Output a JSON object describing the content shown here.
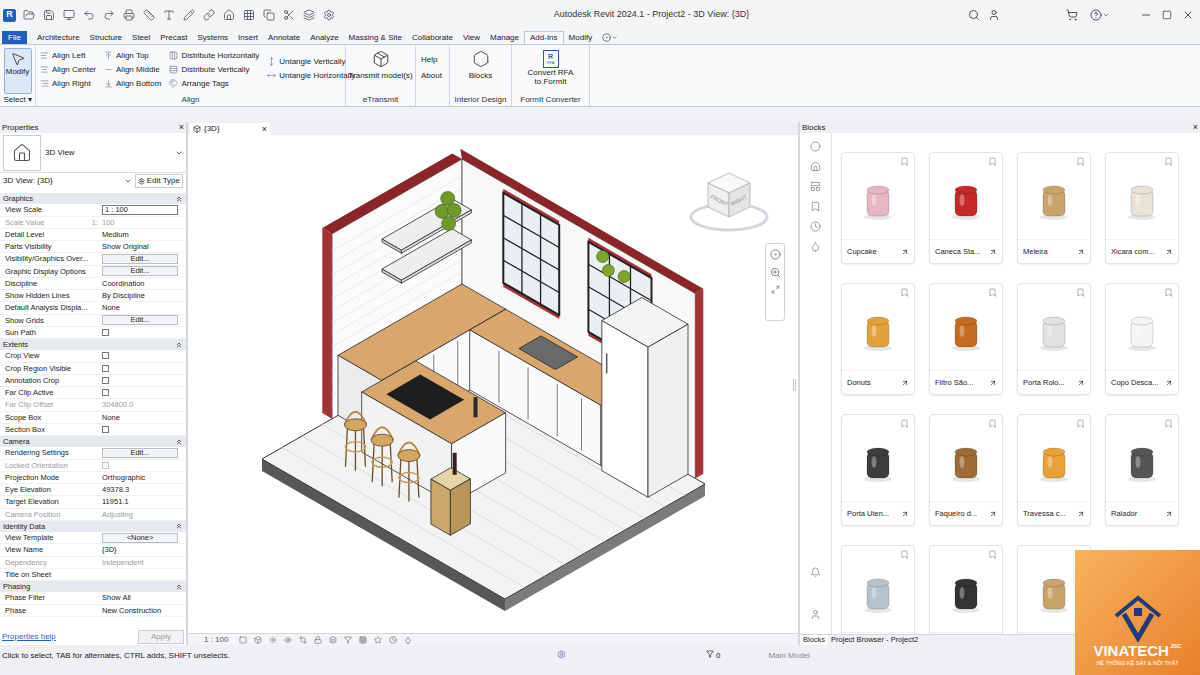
{
  "window": {
    "title": "Autodesk Revit 2024.1 - Project2 - 3D View: {3D}",
    "app_badge": "R"
  },
  "menu_tabs": [
    {
      "label": "File",
      "selected": false,
      "kind": "file"
    },
    {
      "label": "Architecture",
      "selected": false,
      "kind": "tab"
    },
    {
      "label": "Structure",
      "selected": false,
      "kind": "tab"
    },
    {
      "label": "Steel",
      "selected": false,
      "kind": "tab"
    },
    {
      "label": "Precast",
      "selected": false,
      "kind": "tab"
    },
    {
      "label": "Systems",
      "selected": false,
      "kind": "tab"
    },
    {
      "label": "Insert",
      "selected": false,
      "kind": "tab"
    },
    {
      "label": "Annotate",
      "selected": false,
      "kind": "tab"
    },
    {
      "label": "Analyze",
      "selected": false,
      "kind": "tab"
    },
    {
      "label": "Massing & Site",
      "selected": false,
      "kind": "tab"
    },
    {
      "label": "Collaborate",
      "selected": false,
      "kind": "tab"
    },
    {
      "label": "View",
      "selected": false,
      "kind": "tab"
    },
    {
      "label": "Manage",
      "selected": false,
      "kind": "tab"
    },
    {
      "label": "Add-Ins",
      "selected": true,
      "kind": "tab"
    },
    {
      "label": "Modify",
      "selected": false,
      "kind": "tab"
    }
  ],
  "ribbon": {
    "modify": {
      "label": "Modify",
      "selected": true
    },
    "select": {
      "label": "Select",
      "caret": "▾"
    },
    "align_panel": {
      "title": "Align",
      "columns": [
        [
          "Align Left",
          "Align Center",
          "Align Right"
        ],
        [
          "Align Top",
          "Align Middle",
          "Align Bottom"
        ],
        [
          "Distribute Horizontally",
          "Distribute Vertically",
          "Arrange Tags"
        ],
        [
          "Untangle Vertically",
          "Untangle Horizontally"
        ]
      ]
    },
    "etransmit_panel": {
      "title": "eTransmit",
      "button": "Transmit model(s)"
    },
    "help_panel": {
      "buttons": [
        "Help",
        "About"
      ]
    },
    "interior_panel": {
      "title": "Interior Design",
      "button": "Blocks"
    },
    "formit_panel": {
      "title": "FormIt Converter",
      "button_lines": [
        "Convert RFA",
        "to FormIt"
      ],
      "icon_letter": "R",
      "icon_caption": "RFA"
    }
  },
  "properties": {
    "title": "Properties",
    "close": "×",
    "type_name": "3D View",
    "instance": "3D View: {3D}",
    "edit_type": "Edit Type",
    "sections": [
      {
        "title": "Graphics",
        "expanded": true,
        "rows": [
          {
            "label": "View Scale",
            "value": "1 : 100",
            "kind": "input",
            "disabled": false
          },
          {
            "label": "Scale Value",
            "label_suffix": "1:",
            "value": "100",
            "kind": "text",
            "disabled": true
          },
          {
            "label": "Detail Level",
            "value": "Medium",
            "kind": "text",
            "disabled": false
          },
          {
            "label": "Parts Visibility",
            "value": "Show Original",
            "kind": "text",
            "disabled": false
          },
          {
            "label": "Visibility/Graphics Over...",
            "value": "Edit...",
            "kind": "button",
            "disabled": false
          },
          {
            "label": "Graphic Display Options",
            "value": "Edit...",
            "kind": "button",
            "disabled": false
          },
          {
            "label": "Discipline",
            "value": "Coordination",
            "kind": "text",
            "disabled": false
          },
          {
            "label": "Show Hidden Lines",
            "value": "By Discipline",
            "kind": "text",
            "disabled": false
          },
          {
            "label": "Default Analysis Displa...",
            "value": "None",
            "kind": "text",
            "disabled": false
          },
          {
            "label": "Show Grids",
            "value": "Edit...",
            "kind": "button",
            "disabled": false
          },
          {
            "label": "Sun Path",
            "value": "",
            "kind": "checkbox",
            "checked": false,
            "disabled": false
          }
        ]
      },
      {
        "title": "Extents",
        "expanded": true,
        "rows": [
          {
            "label": "Crop View",
            "value": "",
            "kind": "checkbox",
            "checked": false,
            "disabled": false
          },
          {
            "label": "Crop Region Visible",
            "value": "",
            "kind": "checkbox",
            "checked": false,
            "disabled": false
          },
          {
            "label": "Annotation Crop",
            "value": "",
            "kind": "checkbox",
            "checked": false,
            "disabled": false
          },
          {
            "label": "Far Clip Active",
            "value": "",
            "kind": "checkbox",
            "checked": false,
            "disabled": false
          },
          {
            "label": "Far Clip Offset",
            "value": "304800.0",
            "kind": "text",
            "disabled": true
          },
          {
            "label": "Scope Box",
            "value": "None",
            "kind": "text",
            "disabled": false
          },
          {
            "label": "Section Box",
            "value": "",
            "kind": "checkbox",
            "checked": false,
            "disabled": false
          }
        ]
      },
      {
        "title": "Camera",
        "expanded": true,
        "rows": [
          {
            "label": "Rendering Settings",
            "value": "Edit...",
            "kind": "button",
            "disabled": false
          },
          {
            "label": "Locked Orientation",
            "value": "",
            "kind": "checkbox",
            "checked": false,
            "disabled": true
          },
          {
            "label": "Projection Mode",
            "value": "Orthographic",
            "kind": "text",
            "disabled": false
          },
          {
            "label": "Eye Elevation",
            "value": "49378.3",
            "kind": "text",
            "disabled": false
          },
          {
            "label": "Target Elevation",
            "value": "11951.1",
            "kind": "text",
            "disabled": false
          },
          {
            "label": "Camera Position",
            "value": "Adjusting",
            "kind": "text",
            "disabled": true
          }
        ]
      },
      {
        "title": "Identity Data",
        "expanded": true,
        "rows": [
          {
            "label": "View Template",
            "value": "<None>",
            "kind": "button",
            "disabled": false
          },
          {
            "label": "View Name",
            "value": "{3D}",
            "kind": "text",
            "disabled": false
          },
          {
            "label": "Dependency",
            "value": "Independent",
            "kind": "text",
            "disabled": true
          },
          {
            "label": "Title on Sheet",
            "value": "",
            "kind": "text",
            "disabled": false
          }
        ]
      },
      {
        "title": "Phasing",
        "expanded": true,
        "rows": [
          {
            "label": "Phase Filter",
            "value": "Show All",
            "kind": "text",
            "disabled": false
          },
          {
            "label": "Phase",
            "value": "New Construction",
            "kind": "text",
            "disabled": false
          }
        ]
      }
    ],
    "help_link": "Properties help",
    "apply": {
      "label": "Apply",
      "disabled": true
    }
  },
  "view": {
    "tab": {
      "label": "{3D}",
      "close": "×"
    },
    "viewcube": {
      "front": "FRONT",
      "right": "RIGHT"
    },
    "scale": "1 : 100"
  },
  "blocks": {
    "title": "Blocks",
    "close": "×",
    "items": [
      {
        "name": "Cupcake"
      },
      {
        "name": "Caneca Sta..."
      },
      {
        "name": "Meleira"
      },
      {
        "name": "Xicara com..."
      },
      {
        "name": "Donuts"
      },
      {
        "name": "Filtro São..."
      },
      {
        "name": "Porta Rolo..."
      },
      {
        "name": "Copo Desca..."
      },
      {
        "name": "Porta Uten..."
      },
      {
        "name": "Faqueiro d..."
      },
      {
        "name": "Travessa c..."
      },
      {
        "name": "Ralador"
      },
      {
        "name": ""
      },
      {
        "name": ""
      },
      {
        "name": ""
      }
    ]
  },
  "bottom_tabs": [
    {
      "label": "Blocks",
      "selected": true
    },
    {
      "label": "Project Browser - Project2",
      "selected": false
    }
  ],
  "status_bar": {
    "hint": "Click to select, TAB for alternates, CTRL adds, SHIFT unselects.",
    "selection_count": "0",
    "model": "Main Model"
  },
  "watermark": {
    "brand": "VINATECH",
    "suffix": "JSC",
    "tagline": "HỆ THỐNG KỆ SẮT & NỘI THẤT"
  }
}
